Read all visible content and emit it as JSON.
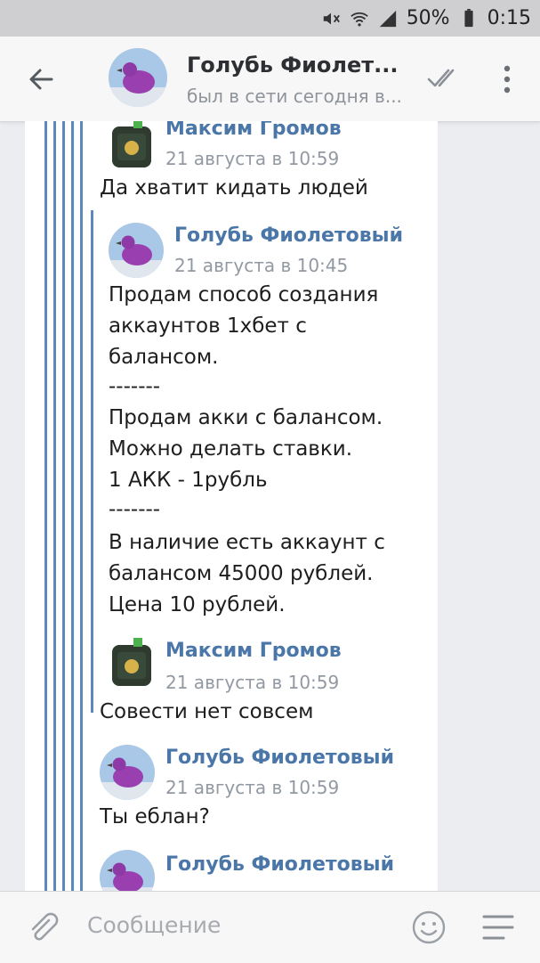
{
  "status_bar": {
    "battery": "50%",
    "time": "0:15"
  },
  "header": {
    "title": "Голубь Фиолет...",
    "subtitle": "был в сети сегодня в..."
  },
  "messages": [
    {
      "author": "Максим Громов",
      "date": "21 августа в 10:59",
      "text": "Да хватит кидать людей",
      "quote": {
        "author": "Голубь Фиолетовый",
        "date": "21 августа в 10:45",
        "lines": [
          "Продам способ создания",
          "аккаунтов 1хбет с",
          "балансом.",
          "-------",
          "Продам акки с балансом.",
          "Можно делать ставки.",
          "1 АКК - 1рубль",
          "-------",
          "В наличие есть аккаунт с",
          "балансом 45000 рублей.",
          "Цена 10 рублей."
        ]
      }
    },
    {
      "author": "Максим Громов",
      "date": "21 августа в 10:59",
      "text": "Совести нет совсем"
    },
    {
      "author": "Голубь Фиолетовый",
      "date": "21 августа в 10:59",
      "text": "Ты еблан?"
    },
    {
      "author": "Голубь Фиолетовый"
    }
  ],
  "composer": {
    "placeholder": "Сообщение"
  },
  "colors": {
    "accent": "#4a76a8",
    "thread_line": "#5b88bd"
  },
  "icons": [
    "mute-icon",
    "wifi-icon",
    "signal-icon",
    "battery-icon",
    "back-arrow-icon",
    "double-check-icon",
    "more-vertical-icon",
    "paperclip-icon",
    "smile-icon",
    "menu-icon"
  ]
}
